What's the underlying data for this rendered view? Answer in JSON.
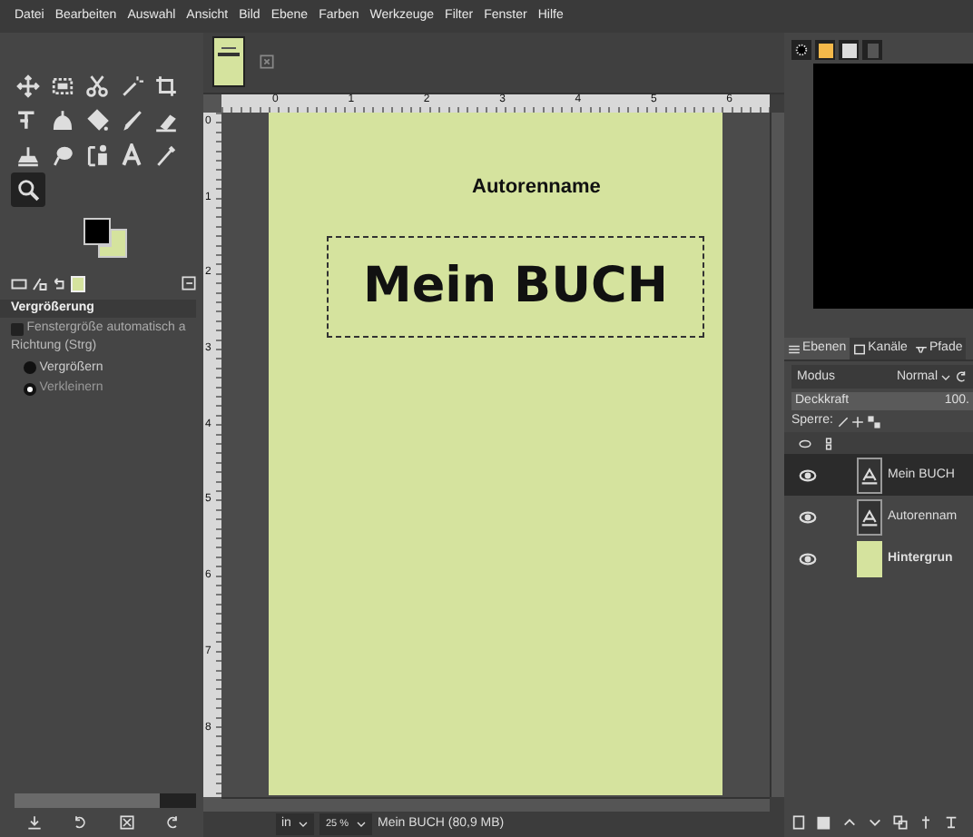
{
  "menu": [
    "Datei",
    "Bearbeiten",
    "Auswahl",
    "Ansicht",
    "Bild",
    "Ebene",
    "Farben",
    "Werkzeuge",
    "Filter",
    "Fenster",
    "Hilfe"
  ],
  "toolbox": {
    "tools": [
      {
        "kind": "move",
        "selected": false
      },
      {
        "kind": "rect",
        "selected": false
      },
      {
        "kind": "scissors",
        "selected": false
      },
      {
        "kind": "wand",
        "selected": false
      },
      {
        "kind": "crop",
        "selected": false
      },
      {
        "kind": "warp",
        "selected": false
      },
      {
        "kind": "smudge",
        "selected": false
      },
      {
        "kind": "bucket",
        "selected": false
      },
      {
        "kind": "brush",
        "selected": false
      },
      {
        "kind": "eraser",
        "selected": false
      },
      {
        "kind": "stamp",
        "selected": false
      },
      {
        "kind": "lasso",
        "selected": false
      },
      {
        "kind": "path",
        "selected": false
      },
      {
        "kind": "text",
        "selected": false
      },
      {
        "kind": "picker",
        "selected": false
      },
      {
        "kind": "zoom",
        "selected": true
      }
    ]
  },
  "tool_options": {
    "title": "Vergrößerung",
    "checkbox": {
      "label": "Fenstergröße automatisch a",
      "checked": false
    },
    "direction_label": "Richtung (Strg)",
    "direction_options": [
      {
        "label": "Vergrößern",
        "selected": false
      },
      {
        "label": "Verkleinern",
        "selected": true
      }
    ]
  },
  "rulers": {
    "horizontal": [
      "0",
      "1",
      "2",
      "3",
      "4",
      "5",
      "6"
    ],
    "vertical": [
      "0",
      "1",
      "2",
      "3",
      "4",
      "5",
      "6",
      "7",
      "8"
    ]
  },
  "canvas": {
    "author": "Autorenname",
    "title": "Mein BUCH"
  },
  "status_bar": {
    "unit": "in",
    "zoom": "25 %",
    "image_info": "Mein BUCH (80,9 MB)"
  },
  "layers_panel": {
    "tabs": [
      {
        "label": "Ebenen",
        "selected": true
      },
      {
        "label": "Kanäle",
        "selected": false
      },
      {
        "label": "Pfade",
        "selected": false
      }
    ],
    "mode_label": "Modus",
    "mode": "Normal",
    "opacity_label": "Deckkraft",
    "opacity": "100.",
    "lock_label": "Sperre:",
    "layers": [
      {
        "name": "Mein BUCH",
        "kind": "text",
        "visible": true,
        "selected": true
      },
      {
        "name": "Autorennam",
        "kind": "text",
        "visible": true,
        "selected": false
      },
      {
        "name": "Hintergrun",
        "kind": "fill",
        "visible": true,
        "selected": false
      }
    ]
  }
}
